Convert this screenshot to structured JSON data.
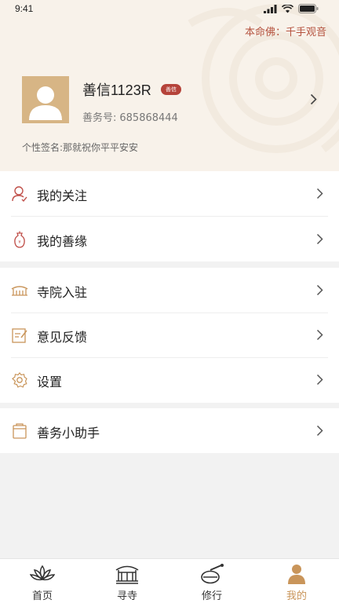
{
  "status": {
    "time": "9:41"
  },
  "header": {
    "benming_label": "本命佛：千手观音"
  },
  "profile": {
    "nickname": "善信1123R",
    "badge": "善信",
    "id_label": "善务号:",
    "id_value": "685868444",
    "signature": "个性签名:那就祝你平平安安"
  },
  "menu_group_1": [
    {
      "label": "我的关注",
      "icon": "user-follow-icon"
    },
    {
      "label": "我的善缘",
      "icon": "incense-bag-icon"
    }
  ],
  "menu_group_2": [
    {
      "label": "寺院入驻",
      "icon": "temple-icon"
    },
    {
      "label": "意见反馈",
      "icon": "feedback-edit-icon"
    },
    {
      "label": "设置",
      "icon": "gear-icon"
    }
  ],
  "menu_group_3": [
    {
      "label": "善务小助手",
      "icon": "assistant-book-icon"
    }
  ],
  "tabs": [
    {
      "label": "首页",
      "icon": "lotus-icon"
    },
    {
      "label": "寻寺",
      "icon": "temple-icon"
    },
    {
      "label": "修行",
      "icon": "wooden-fish-icon"
    },
    {
      "label": "我的",
      "icon": "person-icon"
    }
  ],
  "colors": {
    "accent": "#c9955a",
    "badge": "#b5433a",
    "benming": "#b5533f",
    "header_bg": "#f8f2ea"
  }
}
